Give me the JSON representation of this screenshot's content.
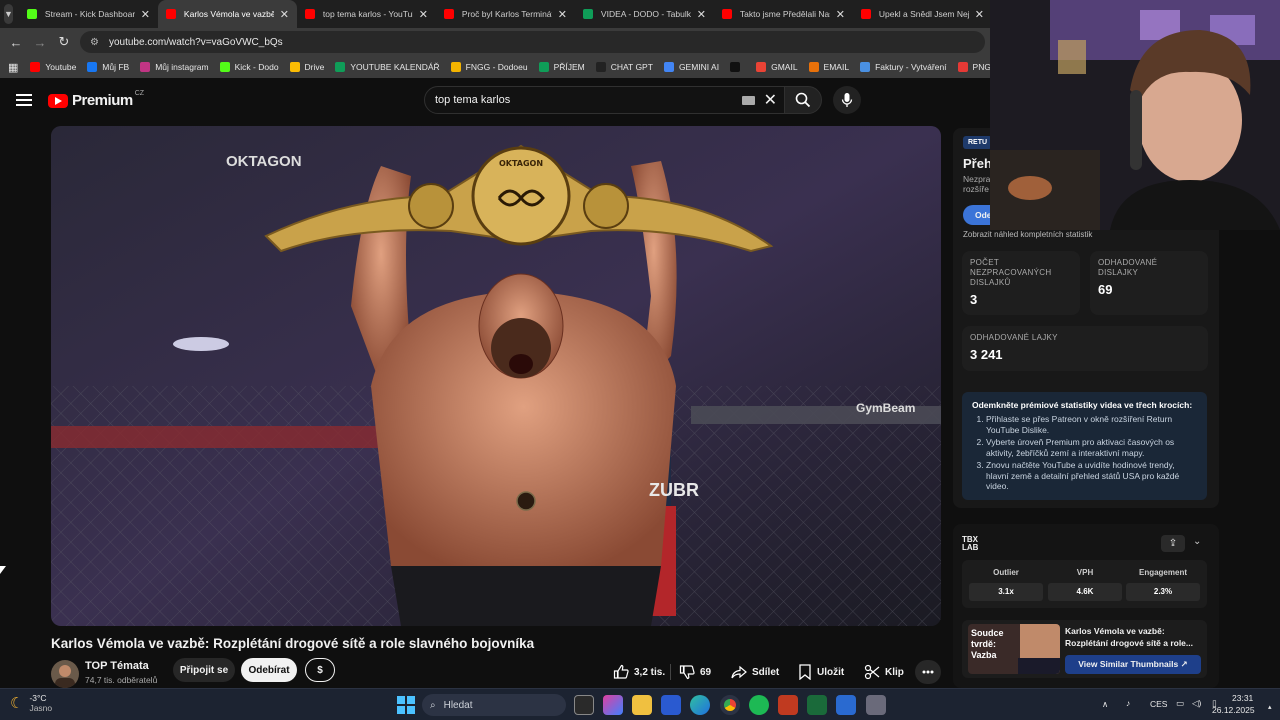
{
  "tabs": [
    {
      "title": "Stream - Kick Dashboard",
      "color": "#53fc18",
      "active": false
    },
    {
      "title": "Karlos Vémola ve vazbě: R",
      "color": "#ff0000",
      "active": true
    },
    {
      "title": "top tema karlos - YouTube",
      "color": "#ff0000",
      "active": false
    },
    {
      "title": "Proč byl Karlos Terminátor",
      "color": "#ff0000",
      "active": false
    },
    {
      "title": "VIDEA - DODO - Tabulky G",
      "color": "#0f9d58",
      "active": false
    },
    {
      "title": "Takto jsme Předělali Naši",
      "color": "#ff0000",
      "active": false
    },
    {
      "title": "Upekl a Snědl Jsem Nejvě",
      "color": "#ff0000",
      "active": false
    }
  ],
  "url": "youtube.com/watch?v=vaGoVWC_bQs",
  "bookmarks": [
    {
      "label": "Youtube",
      "color": "#ff0000"
    },
    {
      "label": "Můj FB",
      "color": "#1877f2"
    },
    {
      "label": "Můj instagram",
      "color": "#c13584"
    },
    {
      "label": "Kick - Dodo",
      "color": "#53fc18"
    },
    {
      "label": "Drive",
      "color": "#fbbc04"
    },
    {
      "label": "YOUTUBE KALENDÁŘ",
      "color": "#0f9d58"
    },
    {
      "label": "FNGG - Dodoeu",
      "color": "#f4b400"
    },
    {
      "label": "PŘÍJEM",
      "color": "#0f9d58"
    },
    {
      "label": "CHAT GPT",
      "color": "#222222"
    },
    {
      "label": "GEMINI AI",
      "color": "#4285f4"
    },
    {
      "label": "",
      "color": "#111111"
    },
    {
      "label": "GMAIL",
      "color": "#ea4335"
    },
    {
      "label": "EMAIL",
      "color": "#e8710a"
    },
    {
      "label": "Faktury - Vytváření",
      "color": "#4a90e2"
    },
    {
      "label": "PNG to PDF",
      "color": "#e53935"
    },
    {
      "label": "ht",
      "color": "#e53935"
    }
  ],
  "youtube": {
    "brand": "Premium",
    "region": "CZ",
    "search_query": "top tema karlos"
  },
  "video": {
    "title": "Karlos Vémola ve vazbě: Rozplétání drogové sítě a role slavného bojovníka",
    "channel": "TOP Témata",
    "subscribers": "74,7 tis. odběratelů",
    "join_label": "Připojit se",
    "subscribe_label": "Odebírat",
    "thanks_label": "$",
    "likes": "3,2 tis.",
    "dislikes": "69",
    "share_label": "Sdílet",
    "save_label": "Uložit",
    "clip_label": "Klip",
    "thumb_texts": {
      "okt1": "OKTAGON",
      "okt2": "OKTAGON",
      "belt": "OKTAGON",
      "zubr": "ZUBR",
      "gymbeam": "GymBeam"
    }
  },
  "extension": {
    "badge": "RETU",
    "heading": "Přeh",
    "desc1": "Nezpra",
    "desc2": "rozšíře",
    "button": "Ode",
    "full_stats_link": "Zobrazit náhled kompletních statistik",
    "stats": [
      {
        "label": "POČET NEZPRACOVANÝCH DISLAJKŮ",
        "value": "3"
      },
      {
        "label": "ODHADOVANÉ DISLAJKY",
        "value": "69"
      },
      {
        "label": "ODHADOVANÉ LAJKY",
        "value": "3 241"
      }
    ],
    "premium_title": "Odemkněte prémiové statistiky videa ve třech krocích:",
    "premium_steps": [
      "Přihlaste se přes Patreon v okně rozšíření Return YouTube Dislike.",
      "Vyberte úroveň Premium pro aktivaci časových os aktivity, žebříčků zemí a interaktivní mapy.",
      "Znovu načtěte YouTube a uvidíte hodinové trendy, hlavní země a detailní přehled států USA pro každé video."
    ]
  },
  "tubelab": {
    "logo": "TBX LAB",
    "metrics": [
      {
        "name": "Outlier",
        "value": "3.1x"
      },
      {
        "name": "VPH",
        "value": "4.6K"
      },
      {
        "name": "Engagement",
        "value": "2.3%"
      }
    ],
    "similar_title": "Karlos Vémola ve vazbě: Rozplétání drogové sítě a role...",
    "similar_button": "View Similar Thumbnails",
    "thumb_text": "Soudce tvrdě: Vazba"
  },
  "taskbar": {
    "weather_temp": "-3°C",
    "weather_desc": "Jasno",
    "search_placeholder": "Hledat",
    "lang": "CES",
    "time": "23:31",
    "date": "26.12.2025"
  }
}
